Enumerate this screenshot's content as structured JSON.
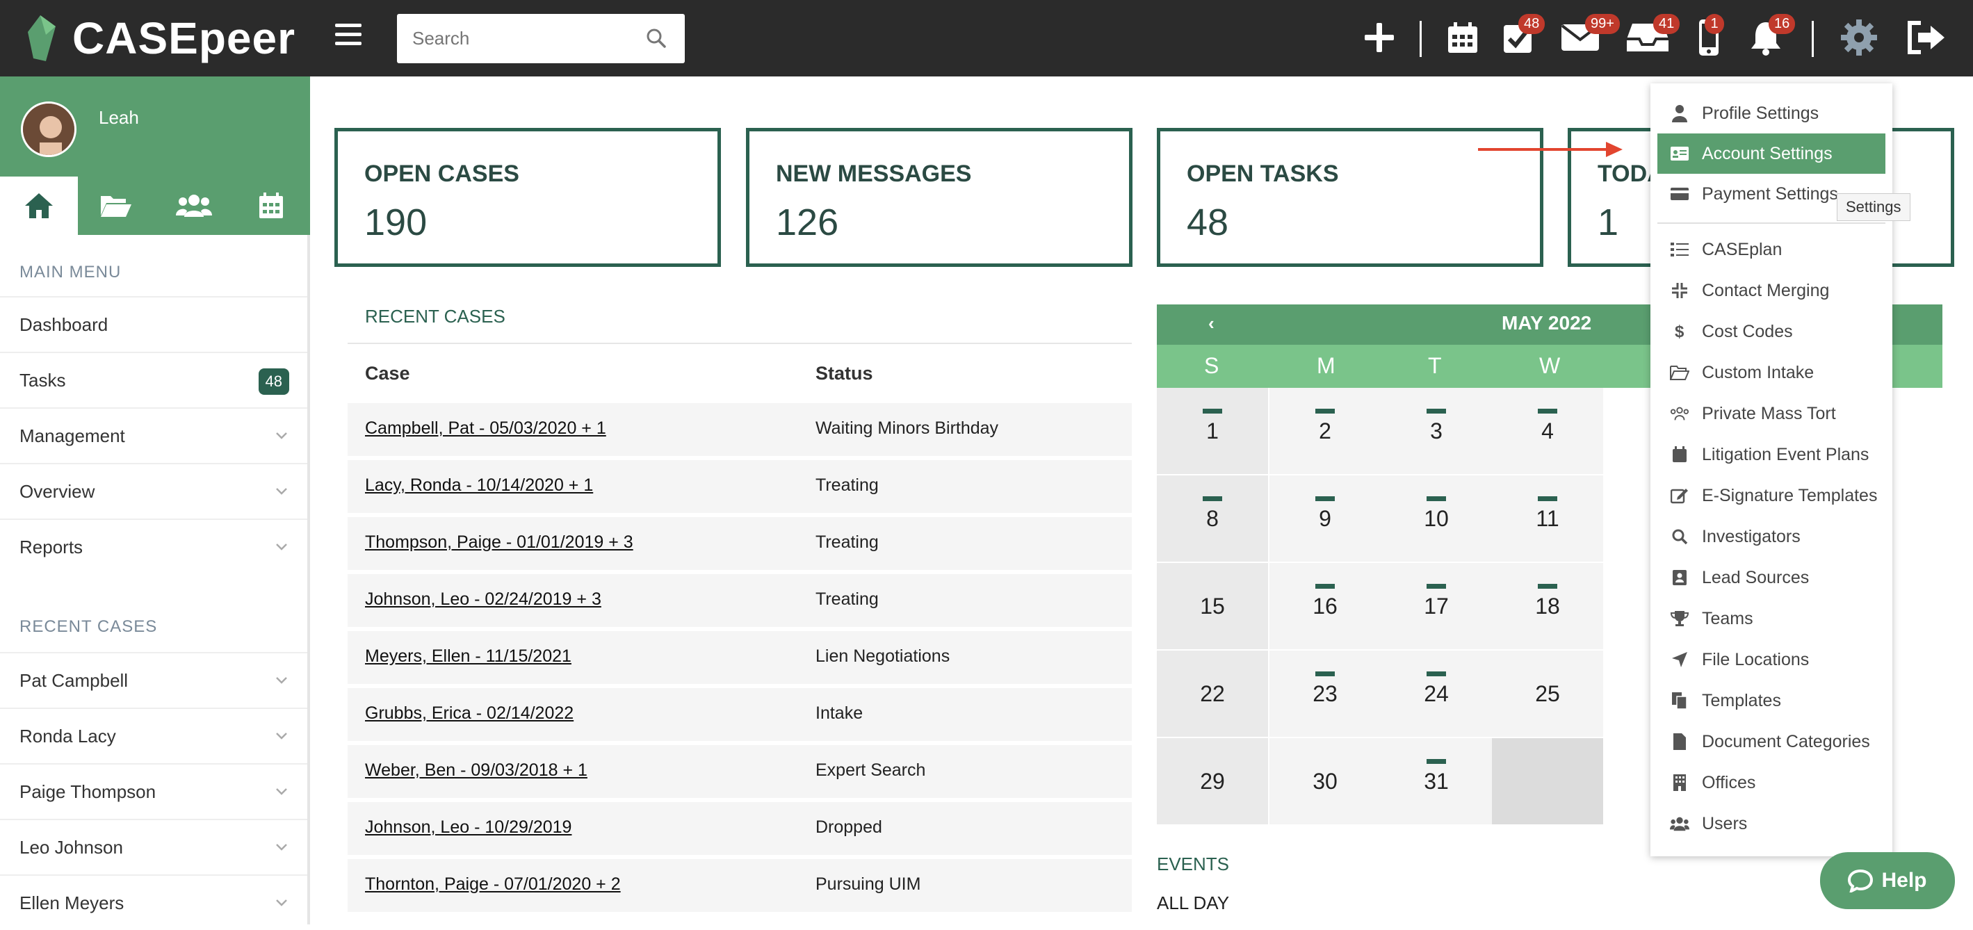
{
  "app": {
    "title": "CASEpeer"
  },
  "header": {
    "search_placeholder": "Search",
    "badges": {
      "tasks": "48",
      "mail": "99+",
      "inbox": "41",
      "phone": "1",
      "notifications": "16"
    }
  },
  "sidebar": {
    "user_name": "Leah",
    "main_menu_title": "MAIN MENU",
    "main_items": [
      {
        "label": "Dashboard"
      },
      {
        "label": "Tasks",
        "count": "48"
      },
      {
        "label": "Management"
      },
      {
        "label": "Overview"
      },
      {
        "label": "Reports"
      }
    ],
    "recent_title": "RECENT CASES",
    "recent_items": [
      "Pat Campbell",
      "Ronda Lacy",
      "Paige Thompson",
      "Leo Johnson",
      "Ellen Meyers"
    ]
  },
  "stats": [
    {
      "label": "OPEN CASES",
      "value": "190"
    },
    {
      "label": "NEW MESSAGES",
      "value": "126"
    },
    {
      "label": "OPEN TASKS",
      "value": "48"
    },
    {
      "label": "TODA",
      "value": "1"
    }
  ],
  "recent_cases": {
    "title": "RECENT CASES",
    "headers": [
      "Case",
      "Status"
    ],
    "rows": [
      {
        "case": "Campbell, Pat - 05/03/2020 + 1",
        "status": "Waiting Minors Birthday"
      },
      {
        "case": "Lacy, Ronda - 10/14/2020 + 1",
        "status": "Treating"
      },
      {
        "case": "Thompson, Paige - 01/01/2019 + 3",
        "status": "Treating"
      },
      {
        "case": "Johnson, Leo - 02/24/2019 + 3",
        "status": "Treating"
      },
      {
        "case": "Meyers, Ellen - 11/15/2021",
        "status": "Lien Negotiations"
      },
      {
        "case": "Grubbs, Erica - 02/14/2022",
        "status": "Intake"
      },
      {
        "case": "Weber, Ben - 09/03/2018 + 1",
        "status": "Expert Search"
      },
      {
        "case": "Johnson, Leo - 10/29/2019",
        "status": "Dropped"
      },
      {
        "case": "Thornton, Paige - 07/01/2020 + 2",
        "status": "Pursuing UIM"
      }
    ]
  },
  "calendar": {
    "prev": "‹",
    "month": "MAY 2022",
    "weekdays": [
      "S",
      "M",
      "T",
      "W"
    ],
    "weeks": [
      [
        "1",
        "2",
        "3",
        "4"
      ],
      [
        "8",
        "9",
        "10",
        "11"
      ],
      [
        "15",
        "16",
        "17",
        "18"
      ],
      [
        "22",
        "23",
        "24",
        "25"
      ],
      [
        "29",
        "30",
        "31",
        ""
      ]
    ],
    "events_title": "EVENTS",
    "all_day": "ALL DAY"
  },
  "settings_menu": {
    "items": [
      {
        "label": "Profile Settings",
        "icon": "user-icon"
      },
      {
        "label": "Account Settings",
        "icon": "id-card-icon",
        "active": true
      },
      {
        "label": "Payment Settings",
        "icon": "credit-card-icon"
      },
      {
        "label": "CASEplan",
        "icon": "list-icon"
      },
      {
        "label": "Contact Merging",
        "icon": "compress-icon"
      },
      {
        "label": "Cost Codes",
        "icon": "dollar-icon"
      },
      {
        "label": "Custom Intake",
        "icon": "folder-open-icon"
      },
      {
        "label": "Private Mass Tort",
        "icon": "users-icon"
      },
      {
        "label": "Litigation Event Plans",
        "icon": "calendar-icon"
      },
      {
        "label": "E-Signature Templates",
        "icon": "edit-icon"
      },
      {
        "label": "Investigators",
        "icon": "search-icon"
      },
      {
        "label": "Lead Sources",
        "icon": "address-book-icon"
      },
      {
        "label": "Teams",
        "icon": "trophy-icon"
      },
      {
        "label": "File Locations",
        "icon": "location-arrow-icon"
      },
      {
        "label": "Templates",
        "icon": "copy-icon"
      },
      {
        "label": "Document Categories",
        "icon": "file-icon"
      },
      {
        "label": "Offices",
        "icon": "building-icon"
      },
      {
        "label": "Users",
        "icon": "users-icon"
      }
    ],
    "tooltip": "Settings"
  },
  "help": {
    "label": "Help"
  },
  "colors": {
    "primary": "#5a9e6f",
    "dark": "#2b6150",
    "header": "#2b2b2b",
    "badge": "#c0392b"
  }
}
